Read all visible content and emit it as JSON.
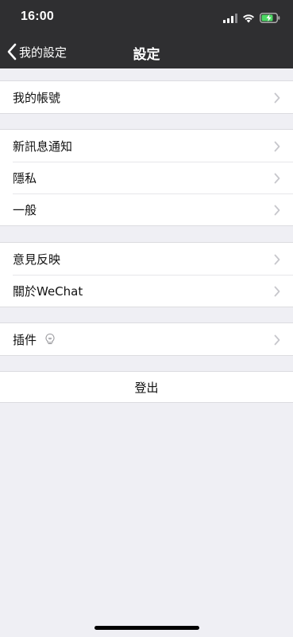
{
  "status_bar": {
    "time": "16:00"
  },
  "nav": {
    "back_label": "我的設定",
    "title": "設定"
  },
  "groups": [
    {
      "items": [
        {
          "label": "我的帳號"
        }
      ]
    },
    {
      "items": [
        {
          "label": "新訊息通知"
        },
        {
          "label": "隱私"
        },
        {
          "label": "一般"
        }
      ]
    },
    {
      "items": [
        {
          "label": "意見反映"
        },
        {
          "label": "關於WeChat"
        }
      ]
    },
    {
      "items": [
        {
          "label": "插件",
          "icon": "lightbulb-icon"
        }
      ]
    }
  ],
  "logout": {
    "label": "登出"
  },
  "colors": {
    "header_bg": "#2f2f31",
    "page_bg": "#efeff4",
    "row_bg": "#ffffff",
    "chevron": "#c7c7cc"
  }
}
